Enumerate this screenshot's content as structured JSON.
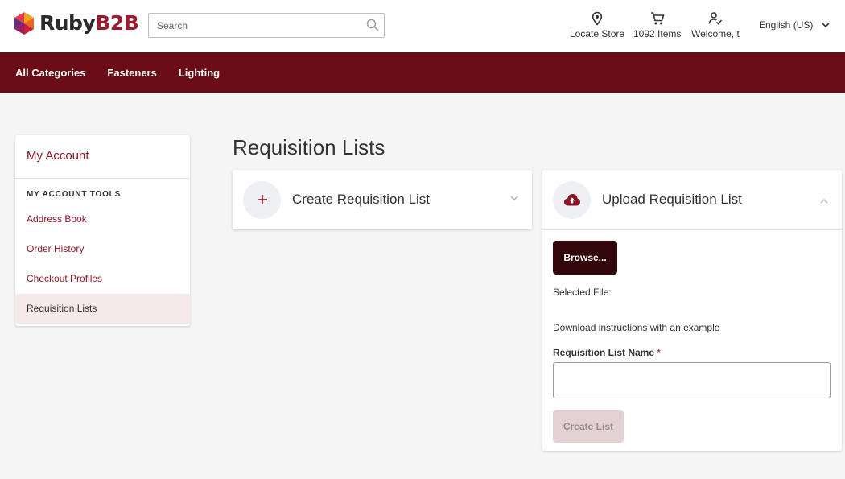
{
  "brand": {
    "name_part1": "Ruby",
    "name_part2": "B2B"
  },
  "search": {
    "placeholder": "Search"
  },
  "header": {
    "locate_store": "Locate Store",
    "cart_items": "1092 Items",
    "welcome": "Welcome, t",
    "language": "English (US)"
  },
  "nav": {
    "items": [
      "All Categories",
      "Fasteners",
      "Lighting"
    ]
  },
  "sidebar": {
    "title": "My Account",
    "section": "MY ACCOUNT TOOLS",
    "items": [
      "Address Book",
      "Order History",
      "Checkout Profiles",
      "Requisition Lists"
    ],
    "active_item": "Requisition Lists"
  },
  "main": {
    "page_title": "Requisition Lists",
    "create_card": {
      "title": "Create Requisition List",
      "icon": "plus-icon"
    },
    "upload_card": {
      "title": "Upload Requisition List",
      "icon": "cloud-upload-icon",
      "browse_label": "Browse...",
      "selected_file_label": "Selected File:",
      "instructions_link": "Download instructions with an example",
      "name_label": "Requisition List Name",
      "required_mark": "*",
      "name_value": "",
      "create_button": "Create List"
    }
  },
  "colors": {
    "brand_dark_red": "#6b0d16",
    "accent_red": "#8a1626",
    "browse_button": "#33060a",
    "disabled_button": "#e3d2d4"
  }
}
